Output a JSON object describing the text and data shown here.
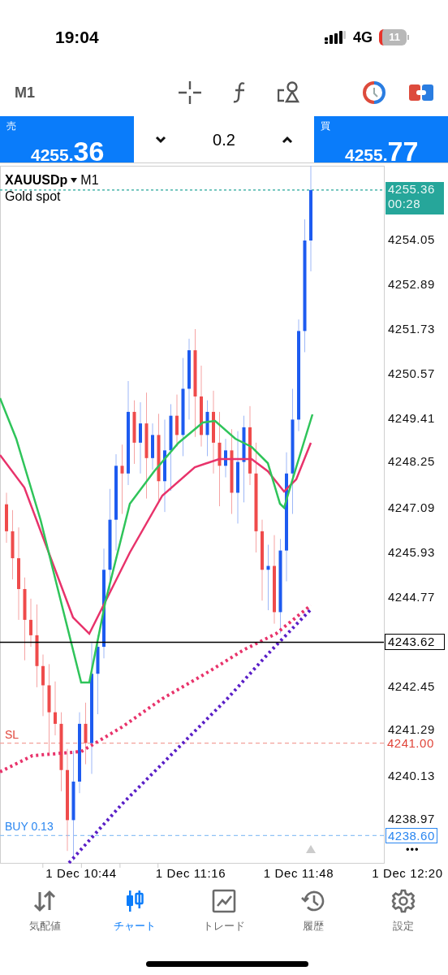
{
  "status_bar": {
    "time": "19:04",
    "network": "4G",
    "battery": "11"
  },
  "toolbar": {
    "timeframe": "M1"
  },
  "trade_bar": {
    "sell": {
      "label": "売",
      "price_small": "4255.",
      "price_big": "36"
    },
    "volume": "0.2",
    "buy": {
      "label": "買",
      "price_small": "4255.",
      "price_big": "77"
    }
  },
  "chart": {
    "symbol": "XAUUSDp",
    "timeframe": "M1",
    "description": "Gold spot",
    "price_labels": [
      "4254.05",
      "4252.89",
      "4251.73",
      "4250.57",
      "4249.41",
      "4248.25",
      "4247.09",
      "4245.93",
      "4244.77",
      "4242.45",
      "4241.29",
      "4240.13",
      "4238.97"
    ],
    "current_price": {
      "price": "4255.36",
      "countdown": "00:28"
    },
    "crosshair_price": "4243.62",
    "order_lines": [
      {
        "kind": "sl",
        "label": "SL",
        "price": "4241.00"
      },
      {
        "kind": "buy",
        "label": "BUY 0.13",
        "price": "4238.60"
      }
    ],
    "more": "•••",
    "time_labels": [
      "1 Dec 10:44",
      "1 Dec 11:16",
      "1 Dec 11:48",
      "1 Dec 12:20"
    ]
  },
  "nav": [
    {
      "label": "気配値",
      "selected": false
    },
    {
      "label": "チャート",
      "selected": true
    },
    {
      "label": "トレード",
      "selected": false
    },
    {
      "label": "履歴",
      "selected": false
    },
    {
      "label": "設定",
      "selected": false
    }
  ]
}
